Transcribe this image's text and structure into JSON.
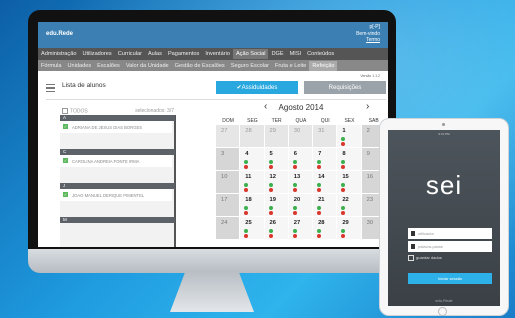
{
  "app": {
    "logo": "edu.Rede",
    "user": {
      "name": "p[-P]",
      "greeting": "Bem-vindo",
      "logout": "Termo"
    },
    "version": "Versão 1.1.2"
  },
  "menu_main": [
    "Administração",
    "Utilizadores",
    "Curricular",
    "Aulas",
    "Pagamentos",
    "Inventário",
    "Ação Social",
    "DGE",
    "MISI",
    "Conteúdos"
  ],
  "menu_main_active": 6,
  "menu_sub": [
    "Fórmula",
    "Unidades",
    "Escalões",
    "Valor da Unidade",
    "Gestão de Escalões",
    "Seguro Escolar",
    "Fruta e Leite",
    "Refeição"
  ],
  "menu_sub_active": 7,
  "page": {
    "title": "Lista de alunos",
    "assiduidades": "✔Assiduidades",
    "requisicoes": "Requisições"
  },
  "students": {
    "todos": "TODOS",
    "selected": "selecionados: 3/7",
    "groups": [
      {
        "letter": "A",
        "names": [
          "ADRIANA DE JESUS DIAS BORGES"
        ]
      },
      {
        "letter": "C",
        "names": [
          "CAROLINA ANDREIA FONTE IRMA"
        ]
      },
      {
        "letter": "J",
        "names": [
          "JOAO MANUEL DERIQUE PIMENTEL"
        ]
      },
      {
        "letter": "M",
        "names": []
      }
    ]
  },
  "calendar": {
    "month": "Agosto 2014",
    "weekdays": [
      "DOM",
      "SEG",
      "TER",
      "QUA",
      "QUI",
      "SEX",
      "SAB"
    ],
    "weeks": [
      [
        27,
        28,
        29,
        30,
        31,
        1,
        2
      ],
      [
        3,
        4,
        5,
        6,
        7,
        8,
        9
      ],
      [
        10,
        11,
        12,
        13,
        14,
        15,
        16
      ],
      [
        17,
        18,
        19,
        20,
        21,
        22,
        23
      ],
      [
        24,
        25,
        26,
        27,
        28,
        29,
        30
      ]
    ]
  },
  "tablet": {
    "status": "9:41 PM",
    "logo": "sei",
    "user_placeholder": "utilizador",
    "pass_placeholder": "palavra-passe",
    "remember": "guardar dados",
    "login": "Iniciar sessão",
    "footer": "edu.Rede"
  }
}
